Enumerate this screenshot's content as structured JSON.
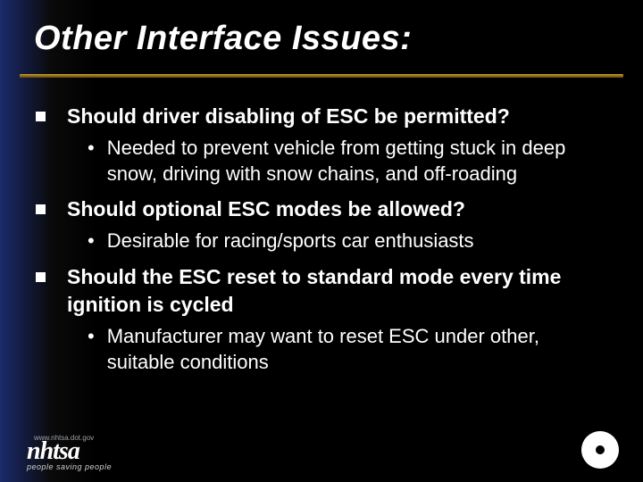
{
  "title": "Other Interface Issues:",
  "bullets": [
    {
      "text": "Should driver disabling of ESC be permitted?",
      "subs": [
        "Needed to prevent vehicle from getting stuck in deep snow, driving with snow chains, and off-roading"
      ]
    },
    {
      "text": "Should optional ESC modes be allowed?",
      "subs": [
        "Desirable for racing/sports car enthusiasts"
      ]
    },
    {
      "text": "Should the ESC reset to standard mode every time ignition is cycled",
      "subs": [
        "Manufacturer may want to reset ESC under other, suitable conditions"
      ]
    }
  ],
  "footer": {
    "url": "www.nhtsa.dot.gov",
    "org": "nhtsa",
    "tagline": "people saving people"
  }
}
